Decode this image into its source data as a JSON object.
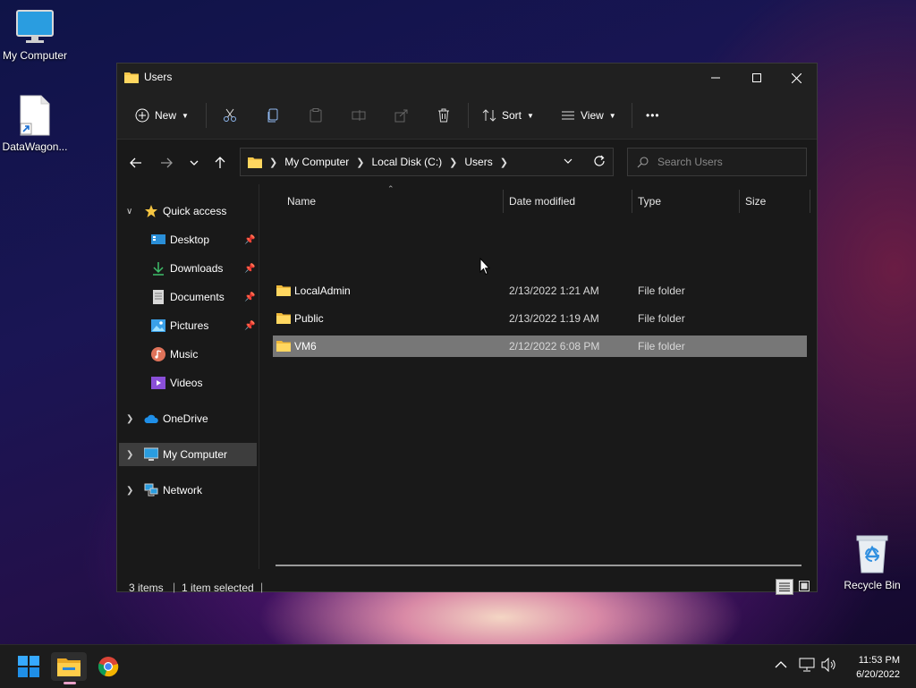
{
  "desktop": {
    "icons": [
      {
        "label": "My Computer"
      },
      {
        "label": "DataWagon..."
      },
      {
        "label": "Recycle Bin"
      }
    ]
  },
  "window": {
    "title": "Users",
    "toolbar": {
      "new_label": "New",
      "sort_label": "Sort",
      "view_label": "View",
      "more_label": "•••"
    },
    "breadcrumb": [
      "My Computer",
      "Local Disk (C:)",
      "Users"
    ],
    "search_placeholder": "Search Users",
    "sidebar": {
      "quick_access": "Quick access",
      "items": [
        {
          "label": "Desktop",
          "pinned": true
        },
        {
          "label": "Downloads",
          "pinned": true
        },
        {
          "label": "Documents",
          "pinned": true
        },
        {
          "label": "Pictures",
          "pinned": true
        },
        {
          "label": "Music",
          "pinned": false
        },
        {
          "label": "Videos",
          "pinned": false
        }
      ],
      "onedrive": "OneDrive",
      "my_computer": "My Computer",
      "network": "Network"
    },
    "columns": {
      "name": "Name",
      "date": "Date modified",
      "type": "Type",
      "size": "Size"
    },
    "rows": [
      {
        "name": "LocalAdmin",
        "date": "2/13/2022 1:21 AM",
        "type": "File folder",
        "selected": false
      },
      {
        "name": "Public",
        "date": "2/13/2022 1:19 AM",
        "type": "File folder",
        "selected": false
      },
      {
        "name": "VM6",
        "date": "2/12/2022 6:08 PM",
        "type": "File folder",
        "selected": true
      }
    ],
    "status": {
      "items": "3 items",
      "selected": "1 item selected"
    }
  },
  "taskbar": {
    "time": "11:53 PM",
    "date": "6/20/2022"
  },
  "colors": {
    "accent": "#0078d4",
    "folder": "#f8c74a",
    "selection": "#777777"
  }
}
